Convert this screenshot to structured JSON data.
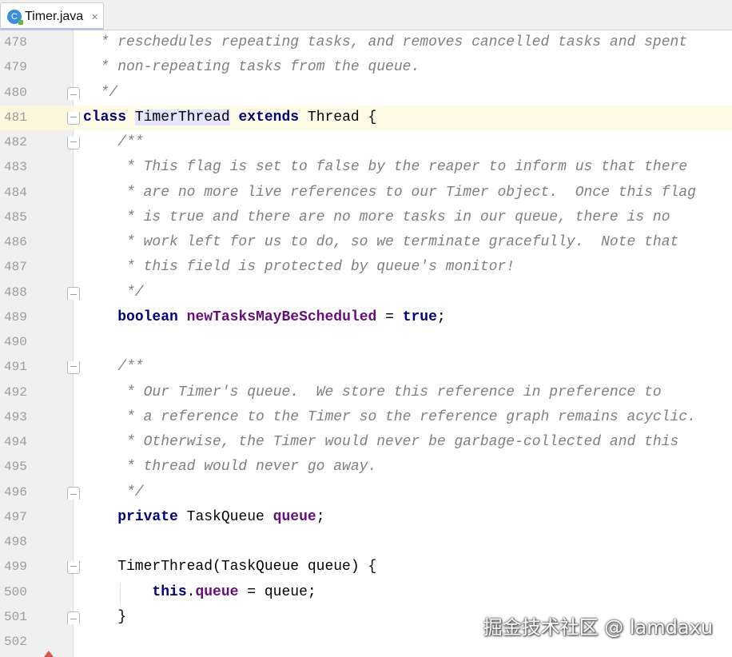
{
  "tab": {
    "label": "Timer.java",
    "icon_letter": "C",
    "close": "×"
  },
  "lines": [
    {
      "num": "478",
      "segments": [
        {
          "t": "  * reschedules repeating tasks, and removes cancelled tasks and spent",
          "c": "cm"
        }
      ]
    },
    {
      "num": "479",
      "segments": [
        {
          "t": "  * non-repeating tasks from the queue.",
          "c": "cm"
        }
      ]
    },
    {
      "num": "480",
      "segments": [
        {
          "t": "  */",
          "c": "cm"
        }
      ],
      "fold": "end"
    },
    {
      "num": "481",
      "segments": [
        {
          "t": "class",
          "c": "kw"
        },
        {
          "t": " ",
          "c": "plain"
        },
        {
          "t": "TimerThread",
          "c": "hl"
        },
        {
          "t": " ",
          "c": "plain"
        },
        {
          "t": "extends",
          "c": "kw"
        },
        {
          "t": " Thread {",
          "c": "plain"
        }
      ],
      "fold": "start",
      "current": true
    },
    {
      "num": "482",
      "segments": [
        {
          "t": "    /**",
          "c": "cm"
        }
      ],
      "fold": "start"
    },
    {
      "num": "483",
      "segments": [
        {
          "t": "     * This flag is set to false by the reaper to inform us that there",
          "c": "cm"
        }
      ]
    },
    {
      "num": "484",
      "segments": [
        {
          "t": "     * are no more live references to our Timer object.  Once this flag",
          "c": "cm"
        }
      ]
    },
    {
      "num": "485",
      "segments": [
        {
          "t": "     * is true and there are no more tasks in our queue, there is no",
          "c": "cm"
        }
      ]
    },
    {
      "num": "486",
      "segments": [
        {
          "t": "     * work left for us to do, so we terminate gracefully.  Note that",
          "c": "cm"
        }
      ]
    },
    {
      "num": "487",
      "segments": [
        {
          "t": "     * this field is protected by queue's monitor!",
          "c": "cm"
        }
      ]
    },
    {
      "num": "488",
      "segments": [
        {
          "t": "     */",
          "c": "cm"
        }
      ],
      "fold": "end"
    },
    {
      "num": "489",
      "segments": [
        {
          "t": "    ",
          "c": "plain"
        },
        {
          "t": "boolean",
          "c": "kw"
        },
        {
          "t": " ",
          "c": "plain"
        },
        {
          "t": "newTasksMayBeScheduled",
          "c": "fld"
        },
        {
          "t": " = ",
          "c": "plain"
        },
        {
          "t": "true",
          "c": "kw"
        },
        {
          "t": ";",
          "c": "plain"
        }
      ]
    },
    {
      "num": "490",
      "segments": []
    },
    {
      "num": "491",
      "segments": [
        {
          "t": "    /**",
          "c": "cm"
        }
      ],
      "fold": "start"
    },
    {
      "num": "492",
      "segments": [
        {
          "t": "     * Our Timer's queue.  We store this reference in preference to",
          "c": "cm"
        }
      ]
    },
    {
      "num": "493",
      "segments": [
        {
          "t": "     * a reference to the Timer so the reference graph remains acyclic.",
          "c": "cm"
        }
      ]
    },
    {
      "num": "494",
      "segments": [
        {
          "t": "     * Otherwise, the Timer would never be garbage-collected and this",
          "c": "cm"
        }
      ]
    },
    {
      "num": "495",
      "segments": [
        {
          "t": "     * thread would never go away.",
          "c": "cm"
        }
      ]
    },
    {
      "num": "496",
      "segments": [
        {
          "t": "     */",
          "c": "cm"
        }
      ],
      "fold": "end"
    },
    {
      "num": "497",
      "segments": [
        {
          "t": "    ",
          "c": "plain"
        },
        {
          "t": "private",
          "c": "kw"
        },
        {
          "t": " TaskQueue ",
          "c": "plain"
        },
        {
          "t": "queue",
          "c": "fld"
        },
        {
          "t": ";",
          "c": "plain"
        }
      ]
    },
    {
      "num": "498",
      "segments": []
    },
    {
      "num": "499",
      "segments": [
        {
          "t": "    TimerThread(TaskQueue queue) {",
          "c": "plain"
        }
      ],
      "fold": "start"
    },
    {
      "num": "500",
      "segments": [
        {
          "t": "        ",
          "c": "plain"
        },
        {
          "t": "this",
          "c": "kw"
        },
        {
          "t": ".",
          "c": "plain"
        },
        {
          "t": "queue",
          "c": "fld"
        },
        {
          "t": " = queue;",
          "c": "plain"
        }
      ]
    },
    {
      "num": "501",
      "segments": [
        {
          "t": "    }",
          "c": "plain"
        }
      ],
      "fold": "end"
    },
    {
      "num": "502",
      "segments": []
    }
  ],
  "watermark": "掘金技术社区 @ lamdaxu"
}
